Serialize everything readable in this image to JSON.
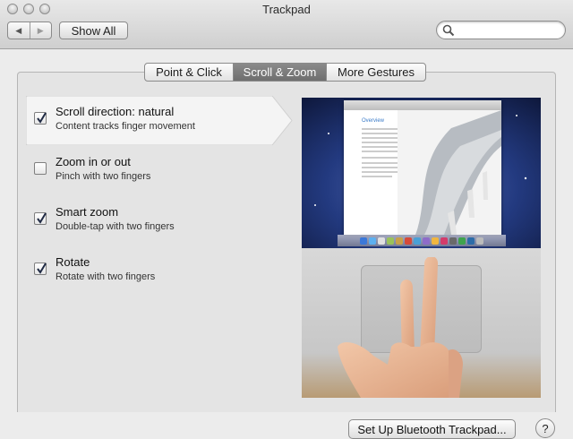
{
  "window": {
    "title": "Trackpad",
    "traffic_lights": [
      "close",
      "minimize",
      "zoom"
    ]
  },
  "toolbar": {
    "back_icon": "triangle-left",
    "forward_icon": "triangle-right",
    "show_all_label": "Show All",
    "search": {
      "value": "",
      "placeholder": "",
      "icon": "magnifier"
    }
  },
  "tabs": [
    {
      "label": "Point & Click",
      "selected": false
    },
    {
      "label": "Scroll & Zoom",
      "selected": true
    },
    {
      "label": "More Gestures",
      "selected": false
    }
  ],
  "options": [
    {
      "title": "Scroll direction: natural",
      "subtitle": "Content tracks finger movement",
      "checked": true,
      "selected": true
    },
    {
      "title": "Zoom in or out",
      "subtitle": "Pinch with two fingers",
      "checked": false,
      "selected": false
    },
    {
      "title": "Smart zoom",
      "subtitle": "Double-tap with two fingers",
      "checked": true,
      "selected": false
    },
    {
      "title": "Rotate",
      "subtitle": "Rotate with two fingers",
      "checked": true,
      "selected": false
    }
  ],
  "preview": {
    "doc_heading": "Overview"
  },
  "footer": {
    "setup_button_label": "Set Up Bluetooth Trackpad...",
    "help_label": "?"
  },
  "colors": {
    "selected_tab": "#7c7c7c",
    "selected_row": "#f4f4f4",
    "checkmark": "#1f2a44",
    "wallpaper": "#1c2f6b"
  }
}
